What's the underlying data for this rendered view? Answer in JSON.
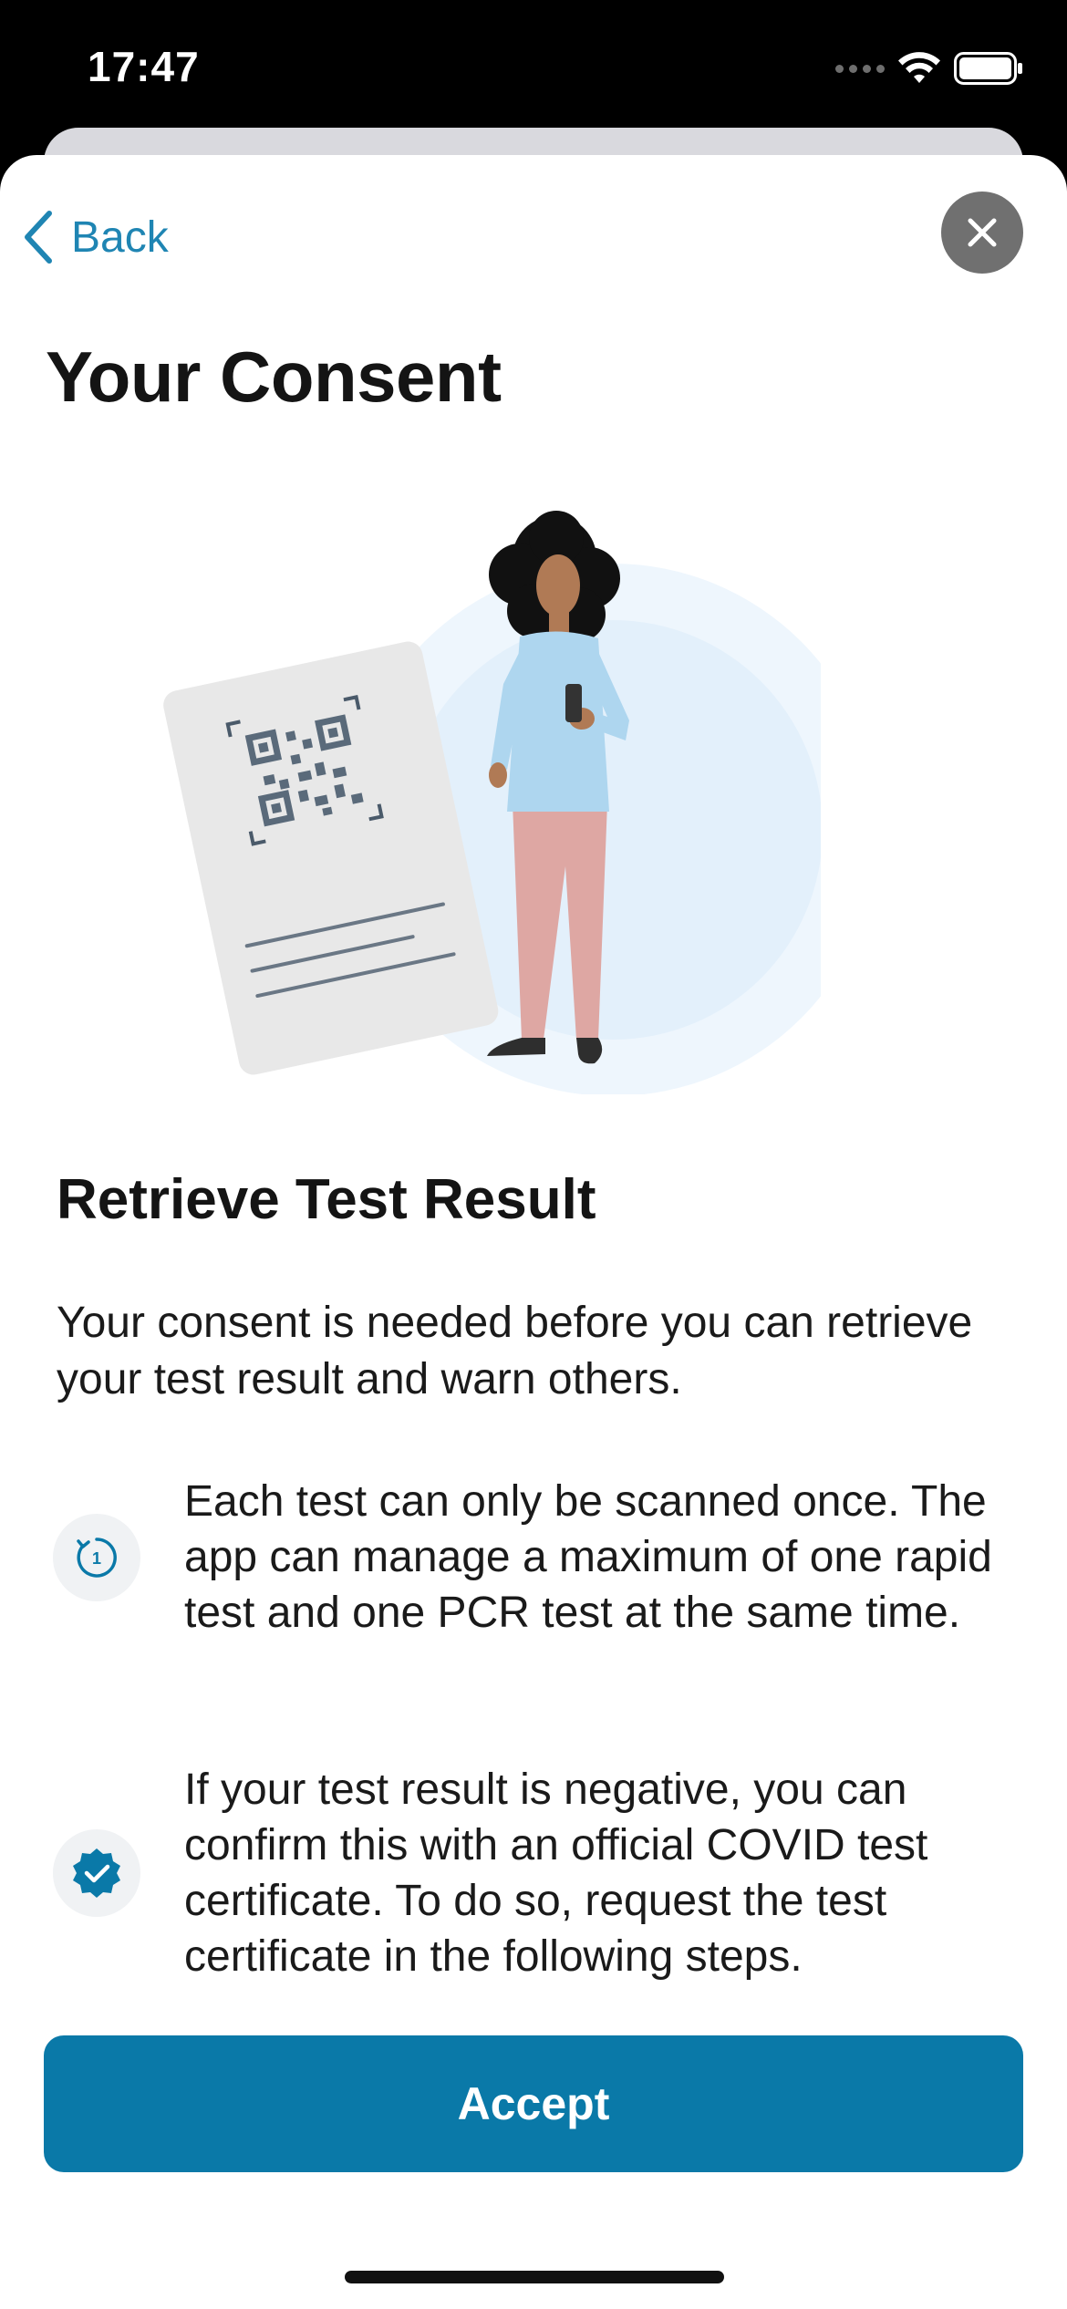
{
  "status_bar": {
    "time": "17:47"
  },
  "nav": {
    "back_label": "Back",
    "close_icon": "close-icon"
  },
  "page": {
    "title": "Your Consent"
  },
  "content": {
    "section_title": "Retrieve Test Result",
    "intro": "Your consent is needed before you can retrieve your test result and warn others.",
    "items": [
      {
        "icon": "counter-one-icon",
        "text": "Each test can only be scanned once. The app can manage a maximum of one rapid test and one PCR test at the same time."
      },
      {
        "icon": "verified-badge-icon",
        "text": "If your test result is negative, you can confirm this with an official COVID test certificate. To do so, request the test certificate in the following steps."
      }
    ]
  },
  "actions": {
    "accept_label": "Accept"
  },
  "colors": {
    "accent": "#0a79a8",
    "link": "#1f85b3",
    "close_bg": "#707070"
  }
}
